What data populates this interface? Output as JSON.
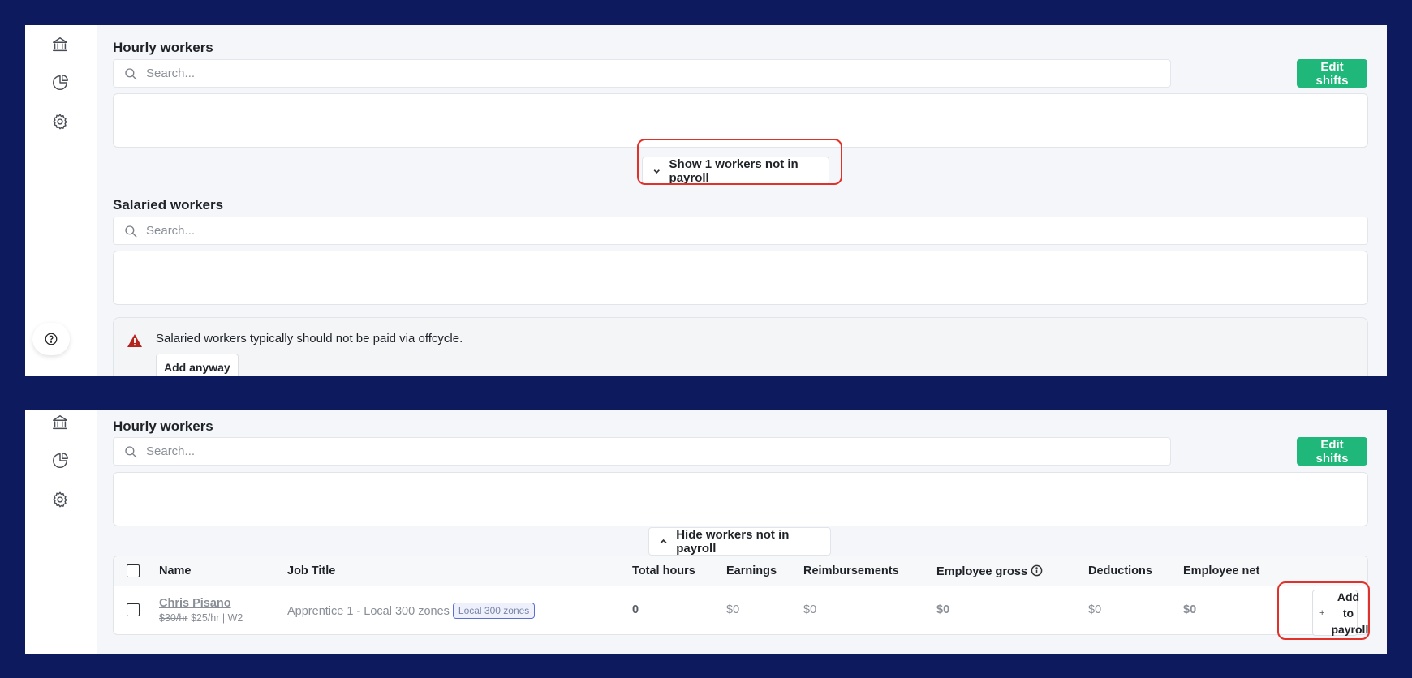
{
  "top_panel": {
    "hourly": {
      "title": "Hourly workers",
      "search_placeholder": "Search...",
      "edit_shifts_label": "Edit shifts",
      "toggle_label": "Show 1 workers not in payroll"
    },
    "salaried": {
      "title": "Salaried workers",
      "search_placeholder": "Search...",
      "warning_text": "Salaried workers typically should not be paid via offcycle.",
      "add_anyway_label": "Add anyway"
    }
  },
  "bottom_panel": {
    "hourly": {
      "title": "Hourly workers",
      "search_placeholder": "Search...",
      "edit_shifts_label": "Edit shifts",
      "toggle_label": "Hide workers not in payroll"
    },
    "table": {
      "headers": {
        "name": "Name",
        "job_title": "Job Title",
        "total_hours": "Total hours",
        "earnings": "Earnings",
        "reimbursements": "Reimbursements",
        "employee_gross": "Employee gross",
        "deductions": "Deductions",
        "employee_net": "Employee net"
      },
      "row": {
        "name": "Chris Pisano",
        "old_rate": "$30/hr",
        "rate_info": "$25/hr | W2",
        "job_title": "Apprentice 1 - Local 300 zones",
        "job_tag": "Local 300 zones",
        "total_hours": "0",
        "earnings": "$0",
        "reimbursements": "$0",
        "employee_gross": "$0",
        "deductions": "$0",
        "employee_net": "$0",
        "add_label_line1": "Add to",
        "add_label_line2": "payroll",
        "add_icon": "+"
      }
    }
  },
  "icons": [
    "bank-icon",
    "pie-chart-icon",
    "gear-icon",
    "help-icon",
    "search-icon",
    "chevron-down-icon",
    "chevron-up-icon",
    "warning-icon",
    "info-icon",
    "plus-icon"
  ],
  "colors": {
    "accent_green": "#1fb87a",
    "highlight_red": "#e0322b",
    "frame_navy": "#0d1b5e",
    "warning_red": "#b3261e"
  }
}
